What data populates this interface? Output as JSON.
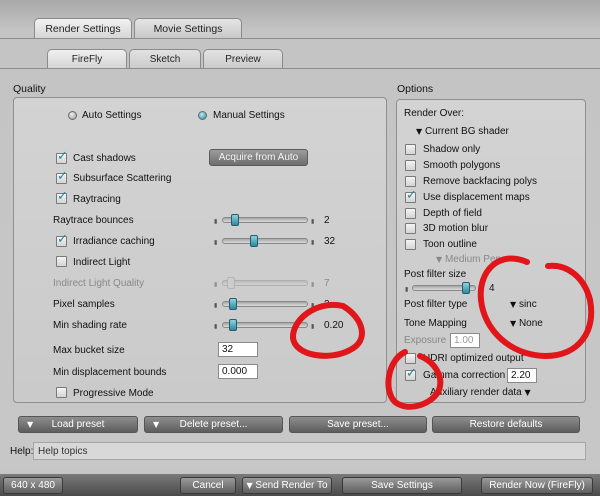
{
  "tabs": [
    "Render Settings",
    "Movie Settings"
  ],
  "subtabs": [
    "FireFly",
    "Sketch",
    "Preview"
  ],
  "quality": {
    "title": "Quality",
    "auto_label": "Auto Settings",
    "manual_label": "Manual Settings",
    "acquire_button": "Acquire from Auto",
    "cast_shadows": "Cast shadows",
    "subsurface": "Subsurface Scattering",
    "raytracing": "Raytracing",
    "raytrace_bounces": "Raytrace bounces",
    "raytrace_bounces_value": "2",
    "raytrace_bounces_level": 0.1,
    "irradiance_caching": "Irradiance caching",
    "irradiance_value": "32",
    "irradiance_level": 0.35,
    "indirect_light": "Indirect Light",
    "indirect_quality": "Indirect Light Quality",
    "indirect_quality_value": "7",
    "indirect_quality_level": 0.05,
    "pixel_samples": "Pixel samples",
    "pixel_samples_value": "3",
    "pixel_samples_level": 0.08,
    "min_shading_rate": "Min shading rate",
    "min_shading_rate_value": "0.20",
    "min_shading_rate_level": 0.08,
    "max_bucket_size": "Max bucket size",
    "max_bucket_size_value": "32",
    "min_displacement": "Min displacement bounds",
    "min_displacement_value": "0.000",
    "progressive_mode": "Progressive Mode"
  },
  "options": {
    "title": "Options",
    "render_over": "Render Over:",
    "render_over_value": "Current BG shader",
    "shadow_only": "Shadow only",
    "smooth_polygons": "Smooth polygons",
    "remove_backfacing": "Remove backfacing polys",
    "use_displacement": "Use displacement maps",
    "depth_of_field": "Depth of field",
    "motion_blur": "3D motion blur",
    "toon_outline": "Toon outline",
    "medium_pen": "Medium Pen",
    "post_filter_size": "Post filter size",
    "post_filter_size_value": "4",
    "post_filter_size_level": 0.9,
    "post_filter_type": "Post filter type",
    "post_filter_type_value": "sinc",
    "tone_mapping": "Tone Mapping",
    "tone_mapping_value": "None",
    "exposure": "Exposure",
    "exposure_value": "1.00",
    "hdri_output": "HDRI optimized output",
    "gamma_correction": "Gamma correction",
    "gamma_value": "2.20",
    "auxiliary": "Auxiliary render data"
  },
  "presets": {
    "load": "Load preset",
    "delete": "Delete preset...",
    "save": "Save preset...",
    "restore": "Restore defaults"
  },
  "help": {
    "label": "Help:",
    "topics": "Help topics"
  },
  "footer": {
    "resolution": "640 x 480",
    "cancel": "Cancel",
    "send_render_to": "Send Render To",
    "save_settings": "Save Settings",
    "render_now": "Render Now (FireFly)"
  },
  "colors": {
    "accent": "#2a8aa0",
    "annotation": "#e0161b"
  }
}
